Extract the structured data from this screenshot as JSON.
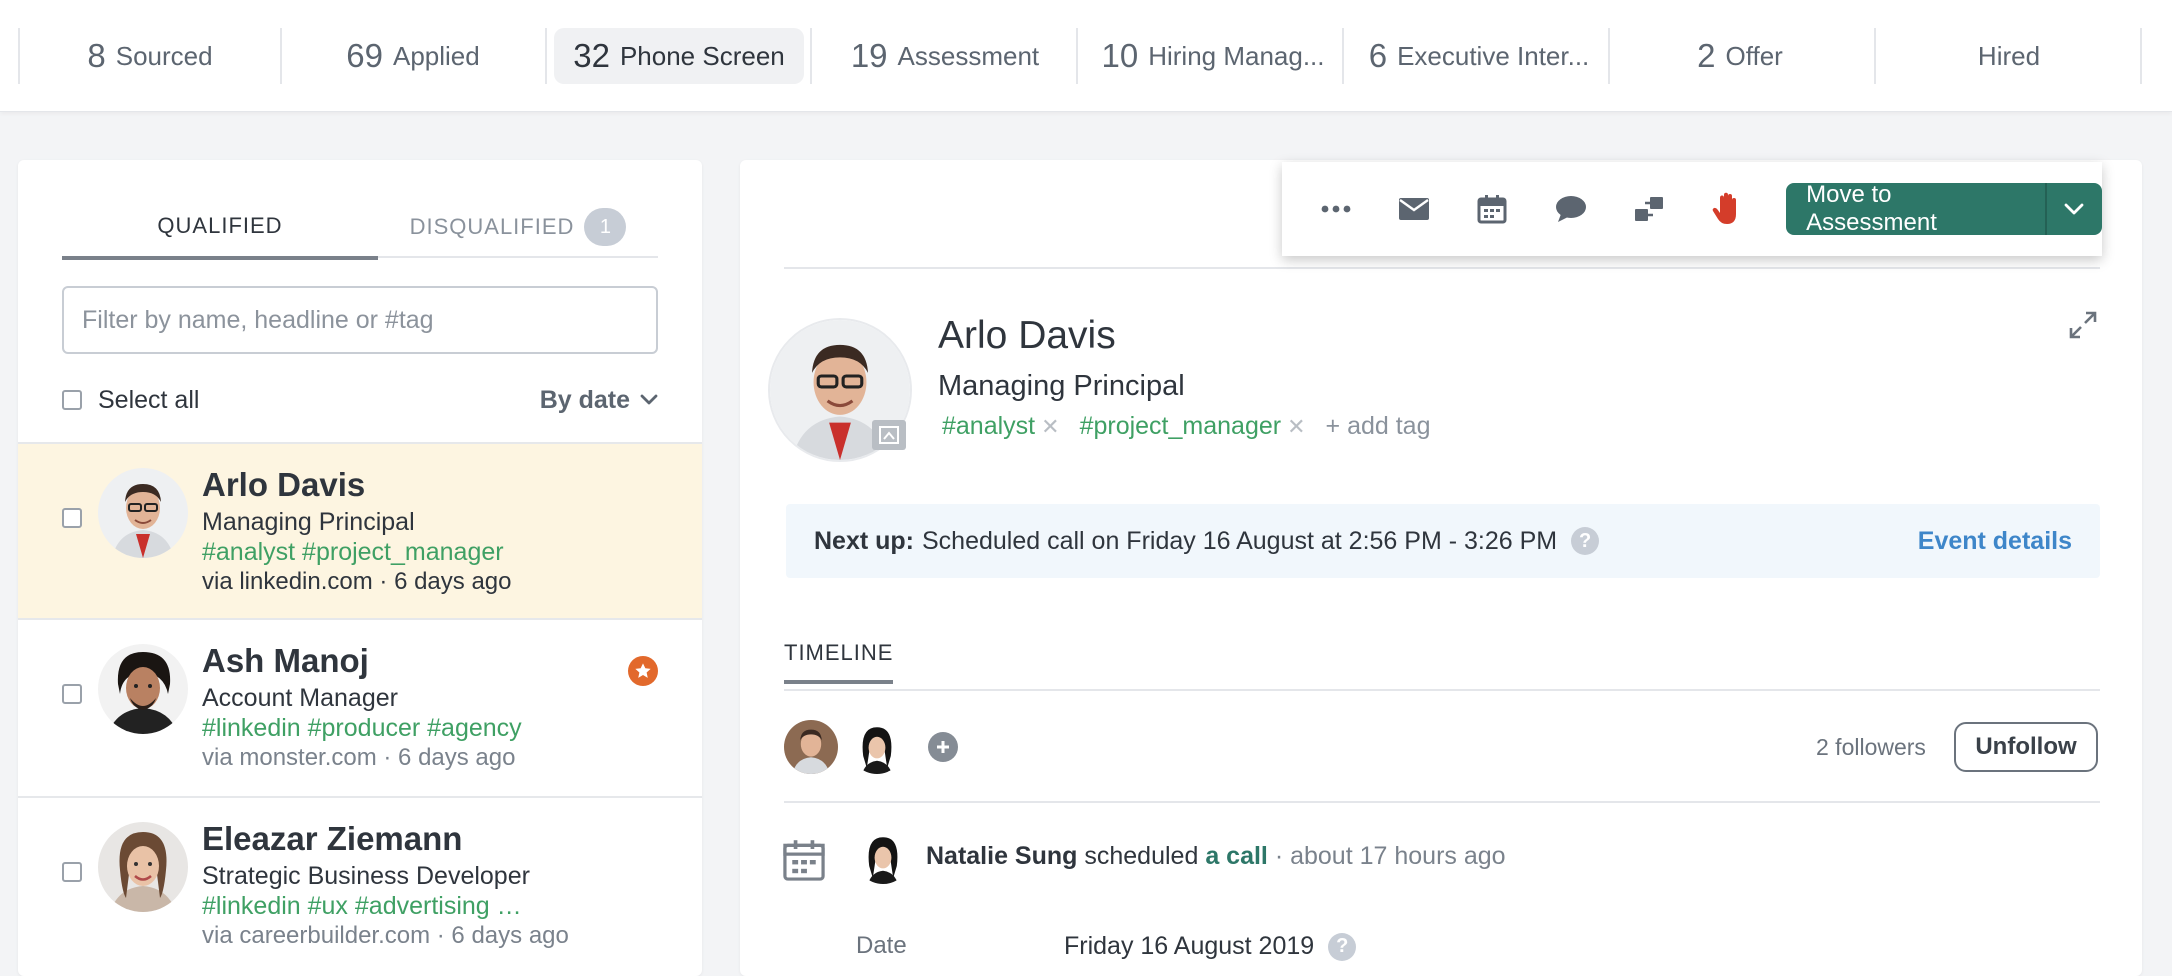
{
  "pipeline": {
    "stages": [
      {
        "count": "8",
        "label": "Sourced",
        "active": false
      },
      {
        "count": "69",
        "label": "Applied",
        "active": false
      },
      {
        "count": "32",
        "label": "Phone Screen",
        "active": true
      },
      {
        "count": "19",
        "label": "Assessment",
        "active": false
      },
      {
        "count": "10",
        "label": "Hiring Manag...",
        "active": false
      },
      {
        "count": "6",
        "label": "Executive Inter...",
        "active": false
      },
      {
        "count": "2",
        "label": "Offer",
        "active": false
      },
      {
        "count": "",
        "label": "Hired",
        "active": false
      }
    ]
  },
  "left": {
    "tabs": {
      "qualified": "QUALIFIED",
      "disqualified": "DISQUALIFIED",
      "disqualified_count": "1"
    },
    "filter": {
      "placeholder": "Filter by name, headline or #tag",
      "value": ""
    },
    "select_all": "Select all",
    "sort": "By date",
    "candidates": [
      {
        "name": "Arlo Davis",
        "headline": "Managing Principal",
        "tags": "#analyst  #project_manager",
        "source": "via linkedin.com · 6 days ago",
        "selected": true,
        "starred": false
      },
      {
        "name": "Ash Manoj",
        "headline": "Account Manager",
        "tags": "#linkedin  #producer  #agency",
        "source": "via monster.com · 6 days ago",
        "selected": false,
        "starred": true
      },
      {
        "name": "Eleazar Ziemann",
        "headline": "Strategic Business Developer",
        "tags": "#linkedin  #ux  #advertising  …",
        "source": "via careerbuilder.com · 6 days ago",
        "selected": false,
        "starred": false
      }
    ]
  },
  "toolbar": {
    "icons": [
      "more-icon",
      "mail-icon",
      "calendar-icon",
      "comment-icon",
      "transfer-icon",
      "disqualify-hand-icon"
    ],
    "move_button": "Move to Assessment"
  },
  "profile": {
    "name": "Arlo Davis",
    "headline": "Managing Principal",
    "tags": [
      "#analyst",
      "#project_manager"
    ],
    "add_tag": "add tag"
  },
  "next_up": {
    "label": "Next up:",
    "text": "Scheduled call on Friday 16 August at 2:56 PM - 3:26 PM",
    "help": "?",
    "link": "Event details"
  },
  "timeline": {
    "tab": "TIMELINE",
    "followers": "2 followers",
    "unfollow": "Unfollow",
    "activity": {
      "who": "Natalie Sung",
      "verb": "scheduled",
      "object": "a call",
      "ago": "· about 17 hours ago"
    },
    "date_label": "Date",
    "date_value": "Friday 16 August 2019"
  },
  "colors": {
    "accent": "#2d7768",
    "tag_green": "#3fa064",
    "link_blue": "#3e86c9",
    "selected_row": "#fdf5e1",
    "star_orange": "#e2692c",
    "disqualify_red": "#d43d2a"
  }
}
